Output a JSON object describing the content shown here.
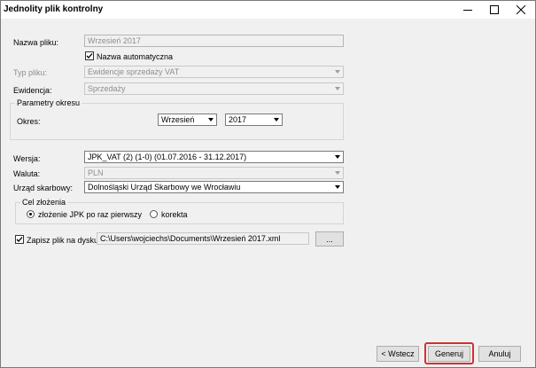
{
  "window": {
    "title": "Jednolity plik kontrolny"
  },
  "form": {
    "nazwa_pliku": {
      "label": "Nazwa pliku:",
      "value": "Wrzesień 2017"
    },
    "nazwa_automatyczna": {
      "label": "Nazwa automatyczna",
      "checked": true
    },
    "typ_pliku": {
      "label": "Typ pliku:",
      "value": "Ewidencje sprzedaży VAT"
    },
    "ewidencja": {
      "label": "Ewidencja:",
      "value": "Sprzedaży"
    },
    "parametry": {
      "group_title": "Parametry okresu",
      "okres_label": "Okres:",
      "month": "Wrzesień",
      "year": "2017"
    },
    "wersja": {
      "label": "Wersja:",
      "value": "JPK_VAT (2) (1-0) (01.07.2016 - 31.12.2017)"
    },
    "waluta": {
      "label": "Waluta:",
      "value": "PLN"
    },
    "urzad": {
      "label": "Urząd skarbowy:",
      "value": "Dolnośląski Urząd Skarbowy we Wrocławiu"
    },
    "cel": {
      "group_title": "Cel złożenia",
      "option1": "złożenie JPK po raz pierwszy",
      "option2": "korekta",
      "selected": "option1"
    },
    "zapisz": {
      "label": "Zapisz plik na dysku",
      "checked": true,
      "path": "C:\\Users\\wojciechs\\Documents\\Wrzesień 2017.xml",
      "browse_label": "..."
    }
  },
  "buttons": {
    "back": "< Wstecz",
    "generate": "Generuj",
    "cancel": "Anuluj"
  },
  "colors": {
    "highlight": "#d62f2f"
  },
  "icons": {
    "minimize": "minimize-icon",
    "maximize": "maximize-icon",
    "close": "close-icon"
  }
}
